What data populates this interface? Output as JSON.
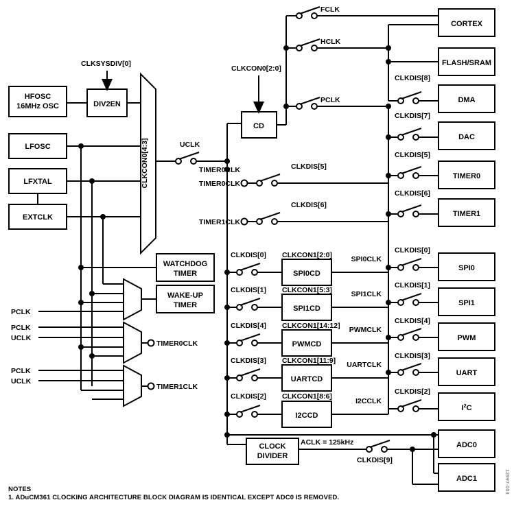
{
  "figure": {
    "id": "12997-003",
    "notes_heading": "NOTES",
    "note_1": "1. ADuCM361 CLOCKING ARCHITECTURE BLOCK DIAGRAM IS IDENTICAL EXCEPT ADC0 IS REMOVED."
  },
  "colors": {
    "line": "#000000",
    "background": "#ffffff",
    "text": "#000000",
    "figure_id": "#8a8f98"
  },
  "sources": {
    "hfosc_line1": "HFOSC",
    "hfosc_line2": "16MHz OSC",
    "lfosc": "LFOSC",
    "lfxtal": "LFXTAL",
    "extclk": "EXTCLK"
  },
  "control_signals": {
    "clksysdiv0": "CLKSYSDIV[0]",
    "clkcon0_4_3": "CLKCON0[4:3]",
    "clkcon0_2_0": "CLKCON0[2:0]"
  },
  "blocks": {
    "div2en": "DIV2EN",
    "cd": "CD",
    "watchdog_line1": "WATCHDOG",
    "watchdog_line2": "TIMER",
    "wakeup_line1": "WAKE-UP",
    "wakeup_line2": "TIMER",
    "clock_divider_line1": "CLOCK",
    "clock_divider_line2": "DIVIDER"
  },
  "dividers": [
    {
      "name": "SPI0CD",
      "control": "CLKCON1[2:0]",
      "disable": "CLKDIS[0]",
      "output": "SPI0CLK"
    },
    {
      "name": "SPI1CD",
      "control": "CLKCON1[5:3]",
      "disable": "CLKDIS[1]",
      "output": "SPI1CLK"
    },
    {
      "name": "PWMCD",
      "control": "CLKCON1[14:12]",
      "disable": "CLKDIS[4]",
      "output": "PWMCLK"
    },
    {
      "name": "UARTCD",
      "control": "CLKCON1[11:9]",
      "disable": "CLKDIS[3]",
      "output": "UARTCLK"
    },
    {
      "name": "I2CCD",
      "control": "CLKCON1[8:6]",
      "disable": "CLKDIS[2]",
      "output": "I2CCLK"
    }
  ],
  "clock_nets": {
    "uclk": "UCLK",
    "fclk": "FCLK",
    "hclk": "HCLK",
    "pclk": "PCLK",
    "timer0clk": "TIMER0CLK",
    "timer1clk": "TIMER1CLK",
    "aclk": "ACLK = 125kHz"
  },
  "mux_inputs": {
    "wakeup_pclk": "PCLK",
    "timer0_pclk": "PCLK",
    "timer0_uclk": "UCLK",
    "timer1_pclk": "PCLK",
    "timer1_uclk": "UCLK"
  },
  "timer_gates": {
    "timer0_disable": "CLKDIS[5]",
    "timer1_disable": "CLKDIS[6]"
  },
  "peripherals": [
    {
      "name": "CORTEX",
      "disable": ""
    },
    {
      "name": "FLASH/SRAM",
      "disable": ""
    },
    {
      "name": "DMA",
      "disable": "CLKDIS[8]"
    },
    {
      "name": "DAC",
      "disable": "CLKDIS[7]"
    },
    {
      "name": "TIMER0",
      "disable": "CLKDIS[5]"
    },
    {
      "name": "TIMER1",
      "disable": "CLKDIS[6]"
    },
    {
      "name": "SPI0",
      "disable": "CLKDIS[0]"
    },
    {
      "name": "SPI1",
      "disable": "CLKDIS[1]"
    },
    {
      "name": "PWM",
      "disable": "CLKDIS[4]"
    },
    {
      "name": "UART",
      "disable": "CLKDIS[3]"
    },
    {
      "name": "I2C",
      "disable": "CLKDIS[2]"
    },
    {
      "name": "ADC0",
      "disable": ""
    },
    {
      "name": "ADC1",
      "disable": ""
    }
  ],
  "adc": {
    "disable": "CLKDIS[9]",
    "i2c_label_main": "I",
    "i2c_label_sup": "2",
    "i2c_label_tail": "C"
  }
}
